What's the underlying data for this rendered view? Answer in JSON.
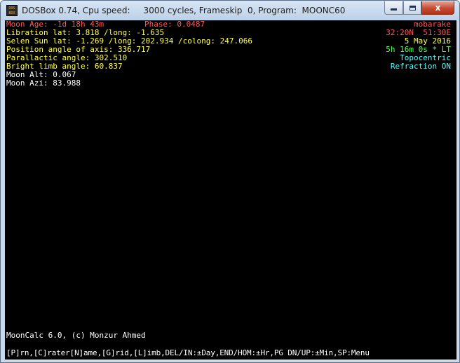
{
  "window": {
    "title": "DOSBox 0.74, Cpu speed:     3000 cycles, Frameskip  0, Program:  MOONC60",
    "icon_top": "DOS",
    "icon_bottom": "BOX",
    "close_symbol": "x"
  },
  "moonc": {
    "left": {
      "age_label": "Moon Age: -1d 18h 43m",
      "phase": "Phase: 0.0487",
      "libration": "Libration lat: 3.818 /long: -1.635",
      "selen_sun": "Selen Sun lat: -1.269 /long: 202.934 /colong: 247.066",
      "position_angle": "Position angle of axis: 336.717",
      "parallactic": "Parallactic angle: 302.510",
      "bright_limb": "Bright limb angle: 60.837",
      "alt": "Moon Alt: 0.067",
      "azi": "Moon Azi: 83.988"
    },
    "right": {
      "location": "mobarake",
      "coords": "32:20N  51:30E",
      "date": "5 May 2016",
      "time": "5h 16m 0s * LT",
      "mode": "Topocentric",
      "refraction": "Refraction ON"
    },
    "credit": "MoonCalc 6.0, (c) Monzur Ahmed",
    "keys": "[P]rn,[C]rater[N]ame,[G]rid,[L]imb,DEL/IN:±Day,END/HOM:±Hr,PG DN/UP:±Min,SP:Menu"
  },
  "colors": {
    "red": "#ff5555",
    "yellow": "#ffff55",
    "green": "#55ff55",
    "cyan": "#55ffff",
    "white": "#ffffff",
    "background": "#000000"
  }
}
